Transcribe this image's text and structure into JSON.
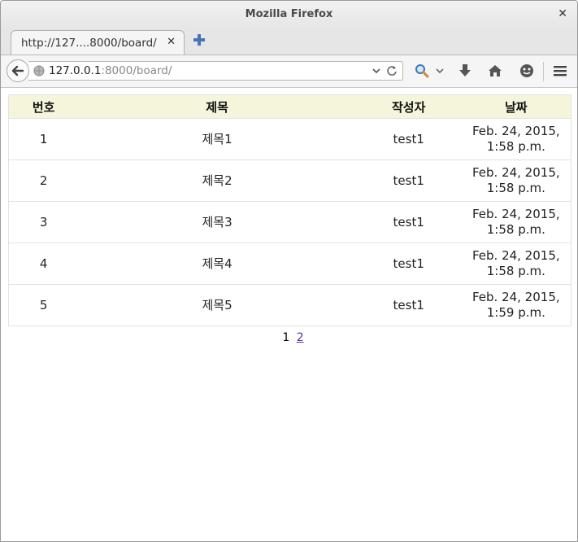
{
  "window": {
    "title": "Mozilla Firefox"
  },
  "tab": {
    "label": "http://127....8000/board/"
  },
  "urlbar": {
    "host": "127.0.0.1",
    "rest": ":8000/board/"
  },
  "icons": {
    "close": "close-icon",
    "new_tab": "plus-icon",
    "back": "back-arrow-icon",
    "site": "globe-icon",
    "history": "chevron-down-icon",
    "reload": "reload-icon",
    "search": "search-icon",
    "download": "download-icon",
    "home": "home-icon",
    "chat": "chat-icon",
    "menu": "hamburger-menu-icon"
  },
  "colors": {
    "header_bg": "#f5f5dc",
    "link": "#5a2ea6"
  },
  "board": {
    "headers": {
      "number": "번호",
      "title": "제목",
      "author": "작성자",
      "date": "날짜"
    },
    "rows": [
      {
        "number": "1",
        "title": "제목1",
        "author": "test1",
        "date_line1": "Feb. 24, 2015,",
        "date_line2": "1:58 p.m."
      },
      {
        "number": "2",
        "title": "제목2",
        "author": "test1",
        "date_line1": "Feb. 24, 2015,",
        "date_line2": "1:58 p.m."
      },
      {
        "number": "3",
        "title": "제목3",
        "author": "test1",
        "date_line1": "Feb. 24, 2015,",
        "date_line2": "1:58 p.m."
      },
      {
        "number": "4",
        "title": "제목4",
        "author": "test1",
        "date_line1": "Feb. 24, 2015,",
        "date_line2": "1:58 p.m."
      },
      {
        "number": "5",
        "title": "제목5",
        "author": "test1",
        "date_line1": "Feb. 24, 2015,",
        "date_line2": "1:59 p.m."
      }
    ]
  },
  "pagination": {
    "current": "1",
    "next": "2"
  }
}
